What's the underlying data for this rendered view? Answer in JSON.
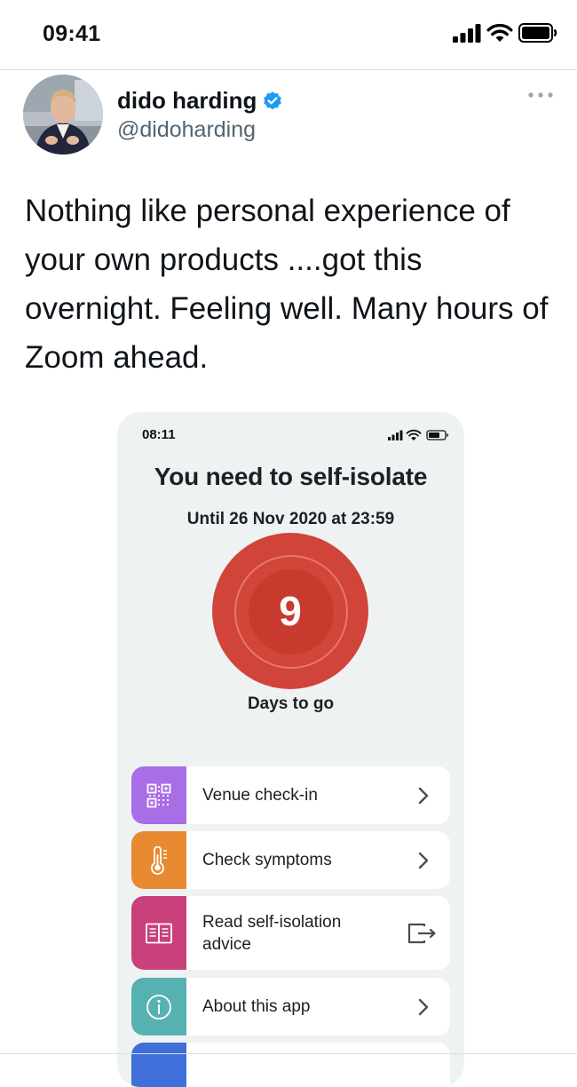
{
  "status_bar": {
    "time": "09:41",
    "icons": [
      "cellular-signal-icon",
      "wifi-icon",
      "battery-icon"
    ]
  },
  "tweet": {
    "author_name": "dido harding",
    "handle": "@didoharding",
    "verified": true,
    "verified_color": "#1d9bf0",
    "more_icon": "more-dots-icon",
    "text": "Nothing like personal experience of your own products ....got this overnight.  Feeling well.  Many hours of Zoom ahead."
  },
  "app_screenshot": {
    "time": "08:11",
    "icons": [
      "cellular-signal-icon",
      "wifi-icon",
      "battery-icon"
    ],
    "title": "You need to self-isolate",
    "until": "Until 26 Nov 2020 at 23:59",
    "days_count": "9",
    "days_label": "Days to go",
    "circle_color": "#d0443a",
    "menu": [
      {
        "label": "Venue check-in",
        "icon": "qr-code-icon",
        "color": "#a96ee6",
        "action_icon": "chevron-right-icon"
      },
      {
        "label": "Check symptoms",
        "icon": "thermometer-icon",
        "color": "#e88a32",
        "action_icon": "chevron-right-icon"
      },
      {
        "label": "Read self-isolation advice",
        "icon": "book-icon",
        "color": "#c9407a",
        "action_icon": "external-link-icon"
      },
      {
        "label": "About this app",
        "icon": "info-icon",
        "color": "#56b2b0",
        "action_icon": "chevron-right-icon"
      }
    ]
  }
}
